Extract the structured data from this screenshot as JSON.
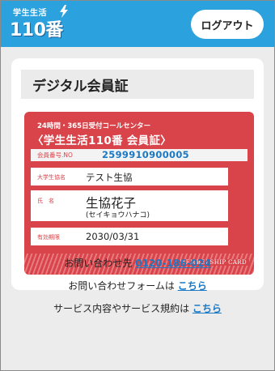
{
  "header": {
    "logo_top": "学生生活",
    "logo_main": "110番",
    "logout_label": "ログアウト"
  },
  "page_title": "デジタル会員証",
  "card": {
    "call_center": "24時間・365日受付コールセンター",
    "service_name": "〈学生生活110番 会員証〉",
    "member_no_label": "会員番号.NO",
    "member_no": "2599910900005",
    "university_label": "大学生協名",
    "university": "テスト生協",
    "name_label": "氏　名",
    "name": "生協花子",
    "name_kana": "(セイキョウハナコ)",
    "expiry_label": "有効期限",
    "expiry": "2030/03/31",
    "stripe_label": "MEMBERSHIP CARD"
  },
  "contact": {
    "phone_label": "お問い合わせ先",
    "phone": "0120-186-024",
    "form_label": "お問い合わせフォームは",
    "form_link": "こちら",
    "terms_label": "サービス内容やサービス規約は",
    "terms_link": "こちら"
  },
  "colors": {
    "header_bg": "#2ba1de",
    "card_red": "#d9434a",
    "link_blue": "#1b78c4"
  },
  "icons": [
    "lightning-bolt-icon"
  ]
}
